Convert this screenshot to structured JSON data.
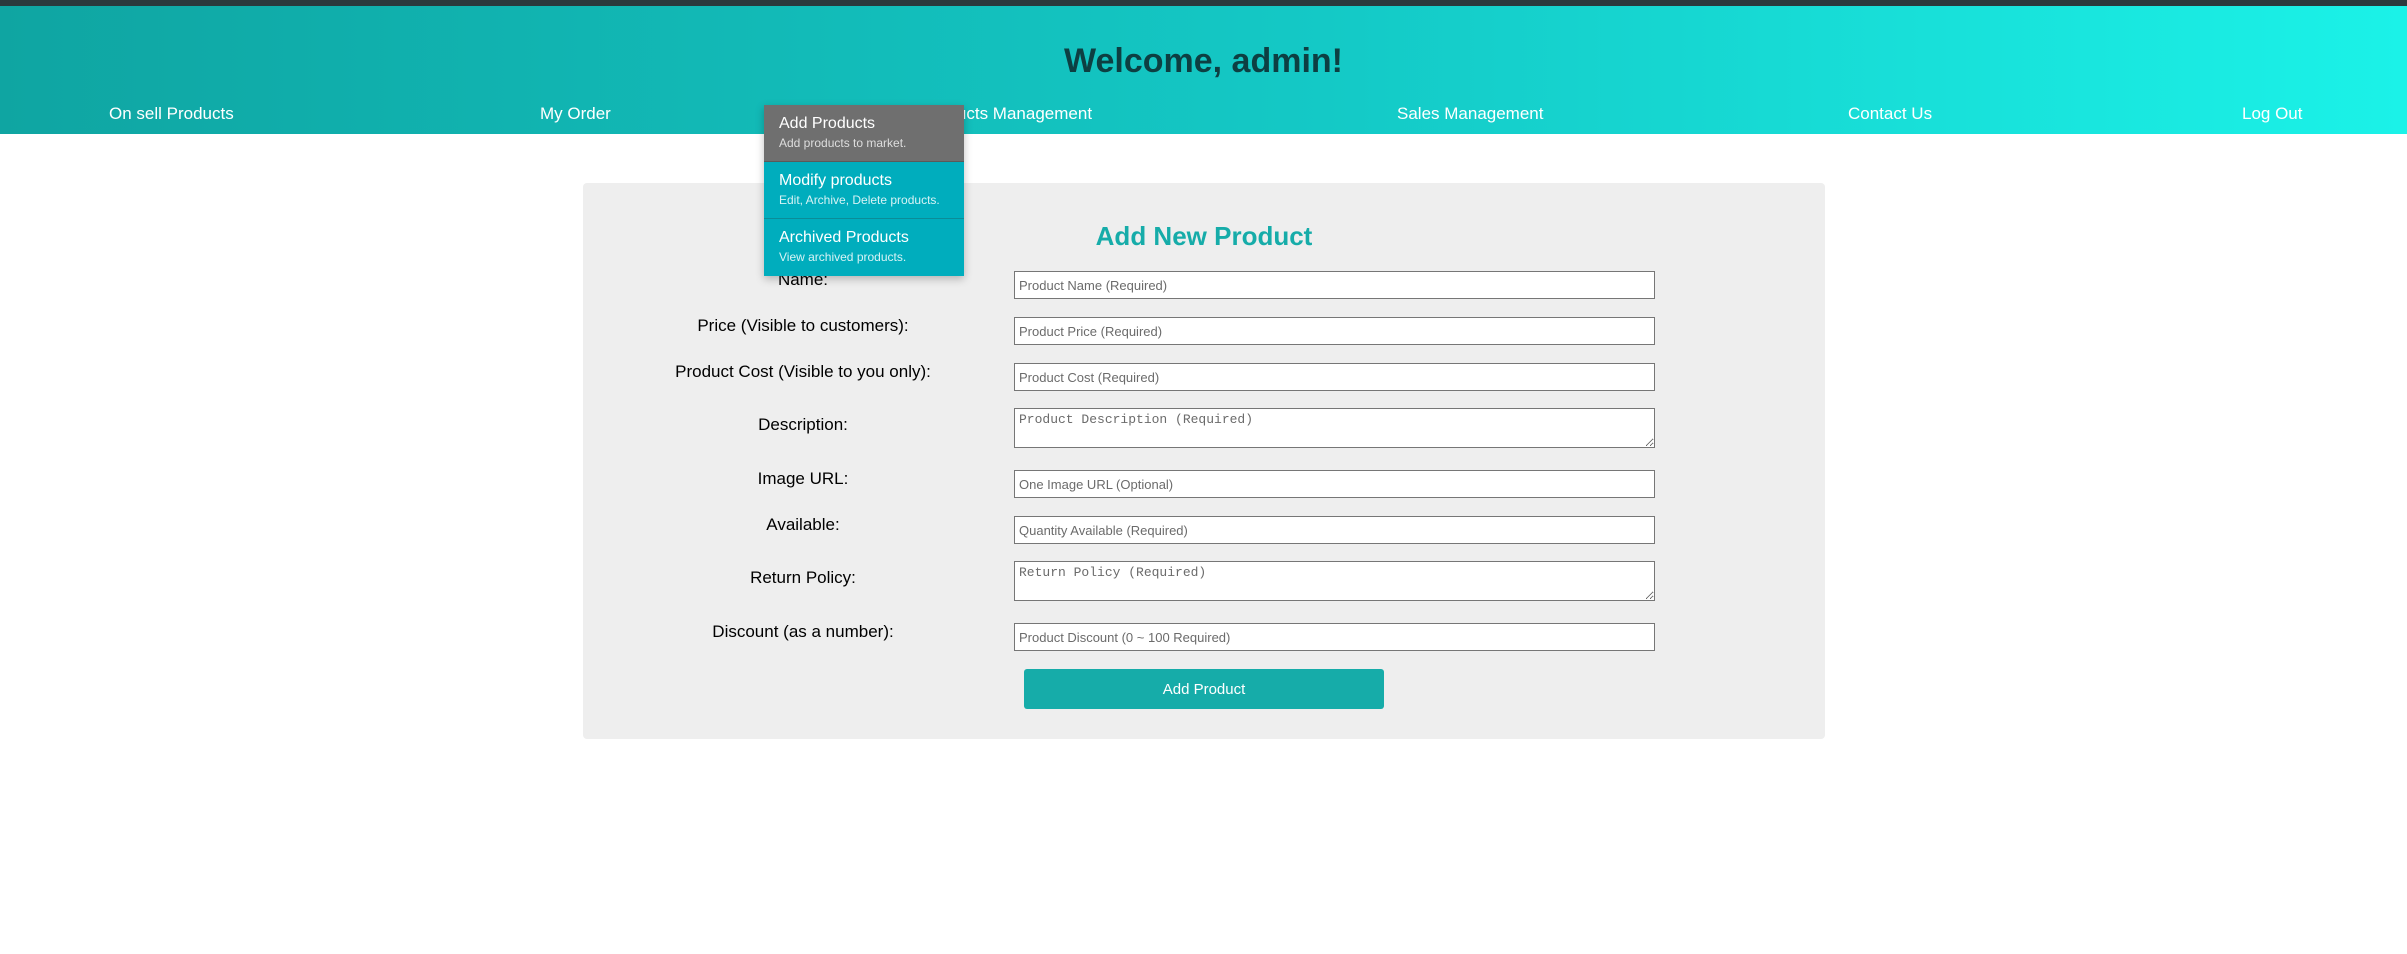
{
  "header": {
    "welcome": "Welcome, admin!",
    "nav": [
      {
        "label": "On sell Products"
      },
      {
        "label": "My Order"
      },
      {
        "label": "Products Management"
      },
      {
        "label": "Sales Management"
      },
      {
        "label": "Contact Us"
      },
      {
        "label": "Log Out"
      }
    ]
  },
  "dropdown": {
    "items": [
      {
        "title": "Add Products",
        "subtitle": "Add products to market."
      },
      {
        "title": "Modify products",
        "subtitle": "Edit, Archive, Delete products."
      },
      {
        "title": "Archived Products",
        "subtitle": "View archived products."
      }
    ]
  },
  "form": {
    "title": "Add New Product",
    "fields": [
      {
        "label": "Name:",
        "placeholder": "Product Name (Required)"
      },
      {
        "label": "Price (Visible to customers):",
        "placeholder": "Product Price (Required)"
      },
      {
        "label": "Product Cost (Visible to you only):",
        "placeholder": "Product Cost (Required)"
      },
      {
        "label": "Description:",
        "placeholder": "Product Description (Required)"
      },
      {
        "label": "Image URL:",
        "placeholder": "One Image URL (Optional)"
      },
      {
        "label": "Available:",
        "placeholder": "Quantity Available (Required)"
      },
      {
        "label": "Return Policy:",
        "placeholder": "Return Policy (Required)"
      },
      {
        "label": "Discount (as a number):",
        "placeholder": "Product Discount (0 ~ 100 Required)"
      }
    ],
    "submit_label": "Add Product"
  },
  "colors": {
    "accent": "#16aca9",
    "header_dark_text": "#0d3f42",
    "dropdown_active": "#6f6f6f",
    "dropdown_bg": "#00adbd",
    "panel_bg": "#eeeeee"
  }
}
